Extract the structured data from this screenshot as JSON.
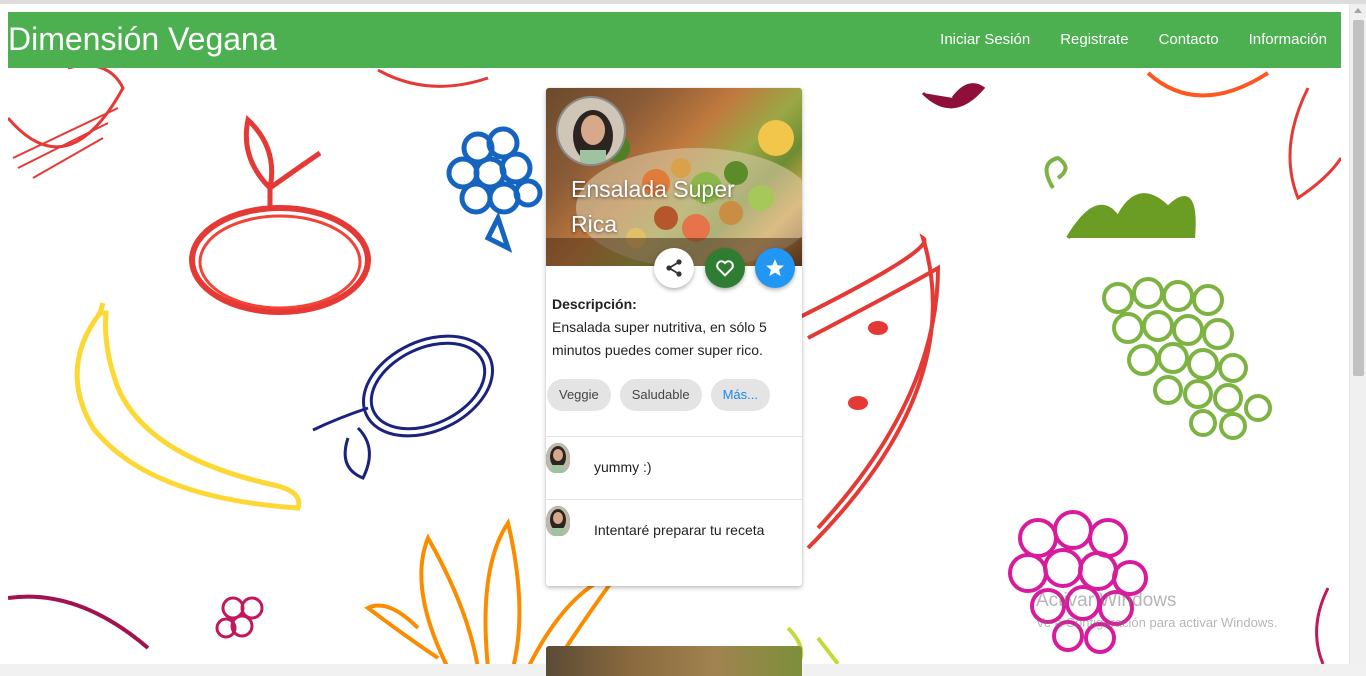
{
  "navbar": {
    "brand": "Dimensión Vegana",
    "links": [
      "Iniciar Sesión",
      "Registrate",
      "Contacto",
      "Información"
    ],
    "color": "#4caf50"
  },
  "card": {
    "title": "Ensalada Super Rica",
    "description_label": "Descripción:",
    "description_text": "Ensalada super nutritiva, en sólo 5 minutos puedes comer super rico.",
    "actions": [
      "share-icon",
      "heart-icon",
      "star-icon"
    ],
    "tags": [
      "Veggie",
      "Saludable",
      "Más..."
    ],
    "comments": [
      {
        "text": "yummy :)"
      },
      {
        "text": "Intentaré preparar tu receta"
      }
    ]
  },
  "watermark": {
    "title": "Activar Windows",
    "subtitle": "Ve a Configuración para activar Windows."
  },
  "colors": {
    "fav_button": "#2e7d32",
    "star_button": "#2196f3",
    "link_more": "#1e88e5"
  }
}
